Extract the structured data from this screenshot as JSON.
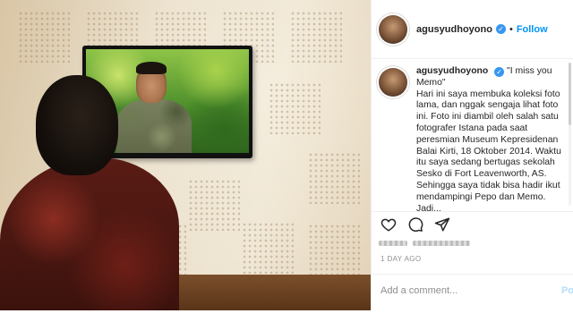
{
  "post": {
    "username": "agusyudhoyono",
    "follow_label": "Follow",
    "separator": "•",
    "caption_quote": "\"I miss you Memo\"",
    "caption_body": "Hari ini saya membuka koleksi foto lama, dan nggak sengaja lihat foto ini. Foto ini diambil oleh salah satu fotografer Istana pada saat peresmian Museum Kepresidenan Balai Kirti, 18 Oktober 2014. Waktu itu saya sedang bertugas sekolah Sesko di Fort Leavenworth, AS. Sehingga saya tidak bisa hadir ikut mendampingi Pepo dan Memo. Jadi...",
    "time_ago": "1 DAY AGO",
    "comment_placeholder": "Add a comment...",
    "post_label": "Po"
  },
  "icons": {
    "verified": "verified-badge-icon",
    "like": "heart-icon",
    "comment": "speech-bubble-icon",
    "share": "paper-plane-icon"
  },
  "colors": {
    "accent": "#0095f6",
    "verified": "#3897f0",
    "muted": "#8e8e8e"
  }
}
